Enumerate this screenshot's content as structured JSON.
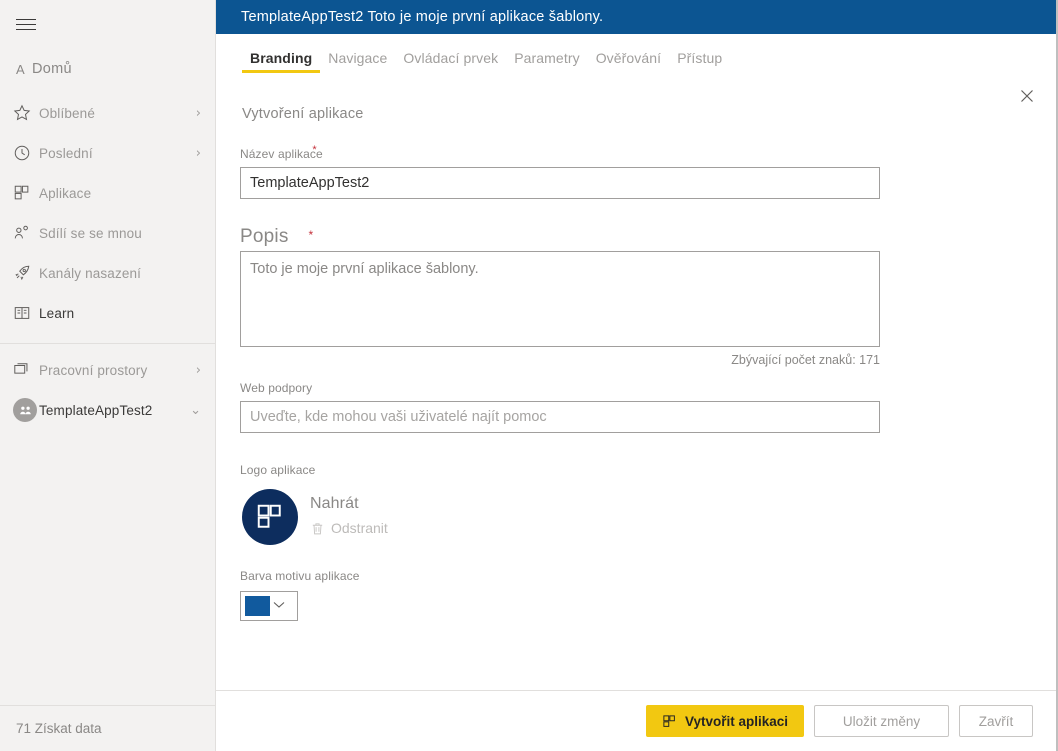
{
  "sidebar": {
    "hamburger_name": "hamburger-menu",
    "home": {
      "glyph": "A",
      "label": "Domů"
    },
    "items": [
      {
        "label": "Oblíbené",
        "icon": "star-icon",
        "chevron": "›"
      },
      {
        "label": "Poslední",
        "icon": "clock-icon",
        "chevron": "›"
      },
      {
        "label": "Aplikace",
        "icon": "apps-grid-icon",
        "chevron": ""
      },
      {
        "label": "Sdílí se se mnou",
        "icon": "shared-person-icon",
        "chevron": ""
      },
      {
        "label": "Kanály nasazení",
        "icon": "rocket-icon",
        "chevron": ""
      },
      {
        "label": "Learn",
        "icon": "book-icon",
        "chevron": ""
      }
    ],
    "groups": [
      {
        "label": "Pracovní prostory",
        "icon": "workspaces-icon",
        "chevron": "›"
      },
      {
        "label": "TemplateAppTest2",
        "icon": "workspace-avatar-icon",
        "chevron": "⌄"
      }
    ],
    "footer": {
      "label": "71 Získat data",
      "icon": "get-data-icon"
    }
  },
  "header": {
    "title": "TemplateAppTest2 Toto je moje první aplikace šablony.",
    "bg_color": "#0c5592"
  },
  "tabs": [
    {
      "label": "Branding",
      "active": true
    },
    {
      "label": "Navigace",
      "active": false
    },
    {
      "label": "Ovládací prvek",
      "active": false
    },
    {
      "label": "Parametry",
      "active": false
    },
    {
      "label": "Ověřování",
      "active": false
    },
    {
      "label": "Přístup",
      "active": false
    }
  ],
  "close_button": {
    "name": "close-dialog-button",
    "glyph": "✕"
  },
  "form": {
    "section_title": "Vytvoření aplikace",
    "app_name": {
      "label": "Název aplikace",
      "required_mark": "*",
      "value": "TemplateAppTest2",
      "placeholder": ""
    },
    "description": {
      "label": "Popis",
      "required_mark": "*",
      "value": "Toto je moje první aplikace šablony.",
      "char_count": "Zbývající počet znaků: 171"
    },
    "support_site": {
      "label": "Web podpory",
      "value": "",
      "placeholder": "Uveďte, kde mohou vaši uživatelé najít pomoc"
    },
    "app_logo": {
      "label": "Logo aplikace",
      "upload_label": "Nahrát",
      "remove_label": "Odstranit",
      "logo_bg_color": "#0d2d5e"
    },
    "theme_color": {
      "label": "Barva motivu aplikace",
      "value_color": "#115a9e",
      "chevron": "⌄"
    }
  },
  "footer_buttons": {
    "create": {
      "label": "Vytvořit aplikaci",
      "icon": "apps-grid-icon",
      "bg": "#f2c811"
    },
    "save": {
      "label": "Uložit změny"
    },
    "close": {
      "label": "Zavřít"
    }
  }
}
